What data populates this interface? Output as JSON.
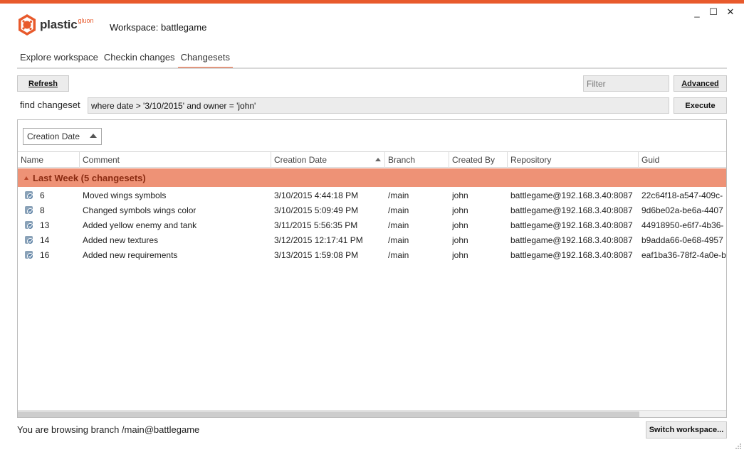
{
  "window": {
    "workspace_title": "Workspace: battlegame",
    "minimize": "_",
    "maximize": "☐",
    "close": "✕"
  },
  "logo": {
    "word": "plastic",
    "sup": "gluon"
  },
  "tabs": [
    {
      "label": "Explore workspace"
    },
    {
      "label": "Checkin changes"
    },
    {
      "label": "Changesets"
    }
  ],
  "toolbar": {
    "refresh_label": "Refresh",
    "filter_placeholder": "Filter",
    "advanced_label": "Advanced",
    "find_label": "find changeset",
    "query_value": "where date > '3/10/2015' and owner = 'john'",
    "execute_label": "Execute"
  },
  "groupby": {
    "value": "Creation Date"
  },
  "columns": [
    "Name",
    "Comment",
    "Creation Date",
    "Branch",
    "Created By",
    "Repository",
    "Guid"
  ],
  "group": {
    "label": "Last Week (5 changesets)"
  },
  "rows": [
    {
      "name": "6",
      "comment": "Moved wings symbols",
      "date": "3/10/2015 4:44:18 PM",
      "branch": "/main",
      "owner": "john",
      "repo": "battlegame@192.168.3.40:8087",
      "guid": "22c64f18-a547-409c-"
    },
    {
      "name": "8",
      "comment": "Changed symbols wings color",
      "date": "3/10/2015 5:09:49 PM",
      "branch": "/main",
      "owner": "john",
      "repo": "battlegame@192.168.3.40:8087",
      "guid": "9d6be02a-be6a-4407"
    },
    {
      "name": "13",
      "comment": "Added yellow enemy and tank",
      "date": "3/11/2015 5:56:35 PM",
      "branch": "/main",
      "owner": "john",
      "repo": "battlegame@192.168.3.40:8087",
      "guid": "44918950-e6f7-4b36-"
    },
    {
      "name": "14",
      "comment": "Added new textures",
      "date": "3/12/2015 12:17:41 PM",
      "branch": "/main",
      "owner": "john",
      "repo": "battlegame@192.168.3.40:8087",
      "guid": "b9adda66-0e68-4957"
    },
    {
      "name": "16",
      "comment": "Added new requirements",
      "date": "3/13/2015 1:59:08 PM",
      "branch": "/main",
      "owner": "john",
      "repo": "battlegame@192.168.3.40:8087",
      "guid": "eaf1ba36-78f2-4a0e-b"
    }
  ],
  "status": {
    "text": "You are browsing branch /main@battlegame",
    "switch_label": "Switch workspace..."
  },
  "colors": {
    "accent": "#e85a2c",
    "group_bg": "#ee9276",
    "group_text": "#8a2a10"
  }
}
